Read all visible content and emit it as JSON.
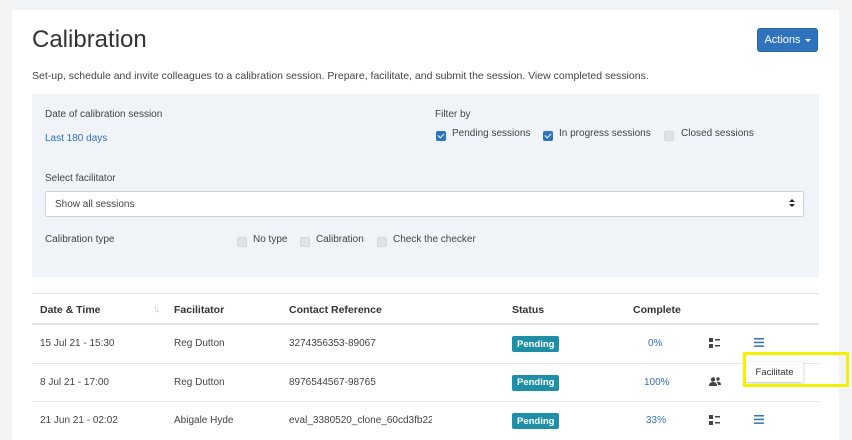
{
  "page": {
    "title": "Calibration",
    "actions_label": "Actions",
    "description": "Set-up, schedule and invite colleagues to a calibration session. Prepare, facilitate, and submit the session. View completed sessions."
  },
  "filters": {
    "date_label": "Date of calibration session",
    "date_value": "Last 180 days",
    "filter_by_label": "Filter by",
    "status_options": [
      {
        "label": "Pending sessions",
        "checked": true
      },
      {
        "label": "In progress sessions",
        "checked": true
      },
      {
        "label": "Closed sessions",
        "checked": false
      }
    ],
    "facilitator_label": "Select facilitator",
    "facilitator_selected": "Show all sessions",
    "type_label": "Calibration type",
    "type_options": [
      {
        "label": "No type",
        "checked": false
      },
      {
        "label": "Calibration",
        "checked": false
      },
      {
        "label": "Check the checker",
        "checked": false
      }
    ]
  },
  "table": {
    "headers": [
      "Date & Time",
      "Facilitator",
      "Contact Reference",
      "Status",
      "Complete"
    ],
    "rows": [
      {
        "datetime": "15 Jul 21 - 15:30",
        "facilitator": "Reg Dutton",
        "contact_ref": "3274356353-89067",
        "status": "Pending",
        "complete": "0%",
        "icon_a": "grid-list-icon",
        "icon_b": "menu-icon"
      },
      {
        "datetime": "8 Jul 21 - 17:00",
        "facilitator": "Reg Dutton",
        "contact_ref": "8976544567-98765",
        "status": "Pending",
        "complete": "100%",
        "icon_a": "people-icon",
        "icon_b": ""
      },
      {
        "datetime": "21 Jun 21 - 02:02",
        "facilitator": "Abigale Hyde",
        "contact_ref": "eval_3380520_clone_60cd3fb22",
        "status": "Pending",
        "complete": "33%",
        "icon_a": "grid-list-icon",
        "icon_b": "menu-icon"
      }
    ]
  },
  "popup": {
    "label": "Facilitate"
  },
  "colors": {
    "accent": "#2f72bd",
    "badge": "#1f8fa8",
    "highlight": "#f4f000"
  }
}
